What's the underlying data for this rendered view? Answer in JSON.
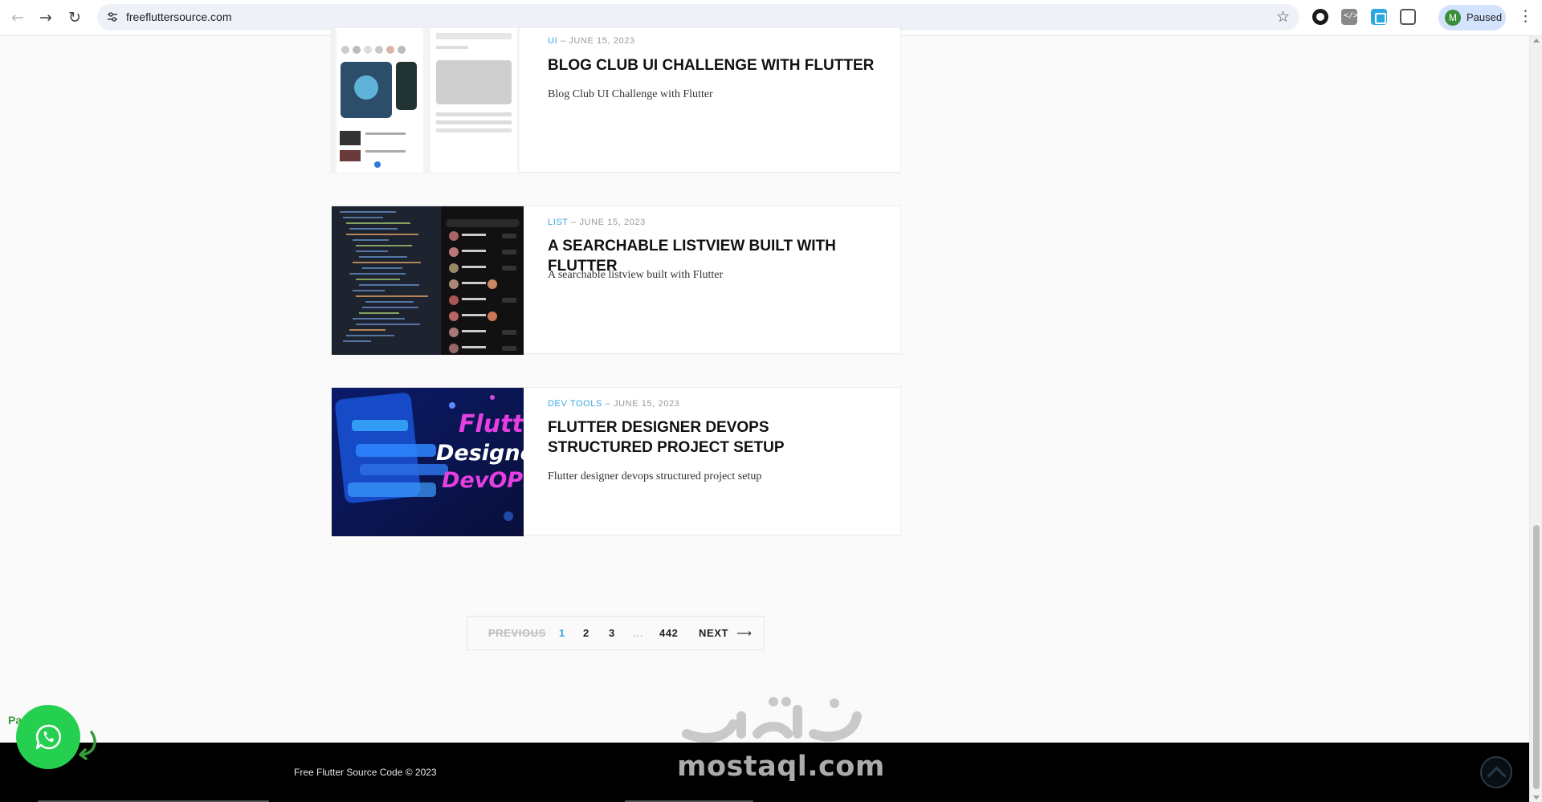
{
  "browser": {
    "url": "freefluttersource.com",
    "profile_initial": "M",
    "profile_status": "Paused"
  },
  "posts": [
    {
      "category": "UI",
      "date": "JUNE 15, 2023",
      "title": "BLOG CLUB UI CHALLENGE WITH FLUTTER",
      "excerpt": "Blog Club UI Challenge with Flutter"
    },
    {
      "category": "LIST",
      "date": "JUNE 15, 2023",
      "title": "A SEARCHABLE LISTVIEW BUILT WITH FLUTTER",
      "excerpt": "A searchable listview built with Flutter"
    },
    {
      "category": "DEV TOOLS",
      "date": "JUNE 15, 2023",
      "title": "FLUTTER DESIGNER DEVOPS STRUCTURED PROJECT SETUP",
      "excerpt": "Flutter designer devops structured project setup"
    }
  ],
  "thumb3_text": {
    "line1": "Flutter",
    "line2": "Designer",
    "line3": "DevOPS"
  },
  "pagination": {
    "previous": "PREVIOUS",
    "pages": [
      "1",
      "2",
      "3"
    ],
    "ellipsis": "…",
    "last": "442",
    "next": "NEXT"
  },
  "footer": {
    "copyright": "Free Flutter Source Code © 2023"
  },
  "watermark": {
    "latin": "mostaql.com"
  },
  "whatsapp": {
    "label": "Pa         tsapp"
  },
  "colors": {
    "accent": "#3aa7e0",
    "whatsapp": "#25cf4f",
    "footer": "#000000"
  }
}
